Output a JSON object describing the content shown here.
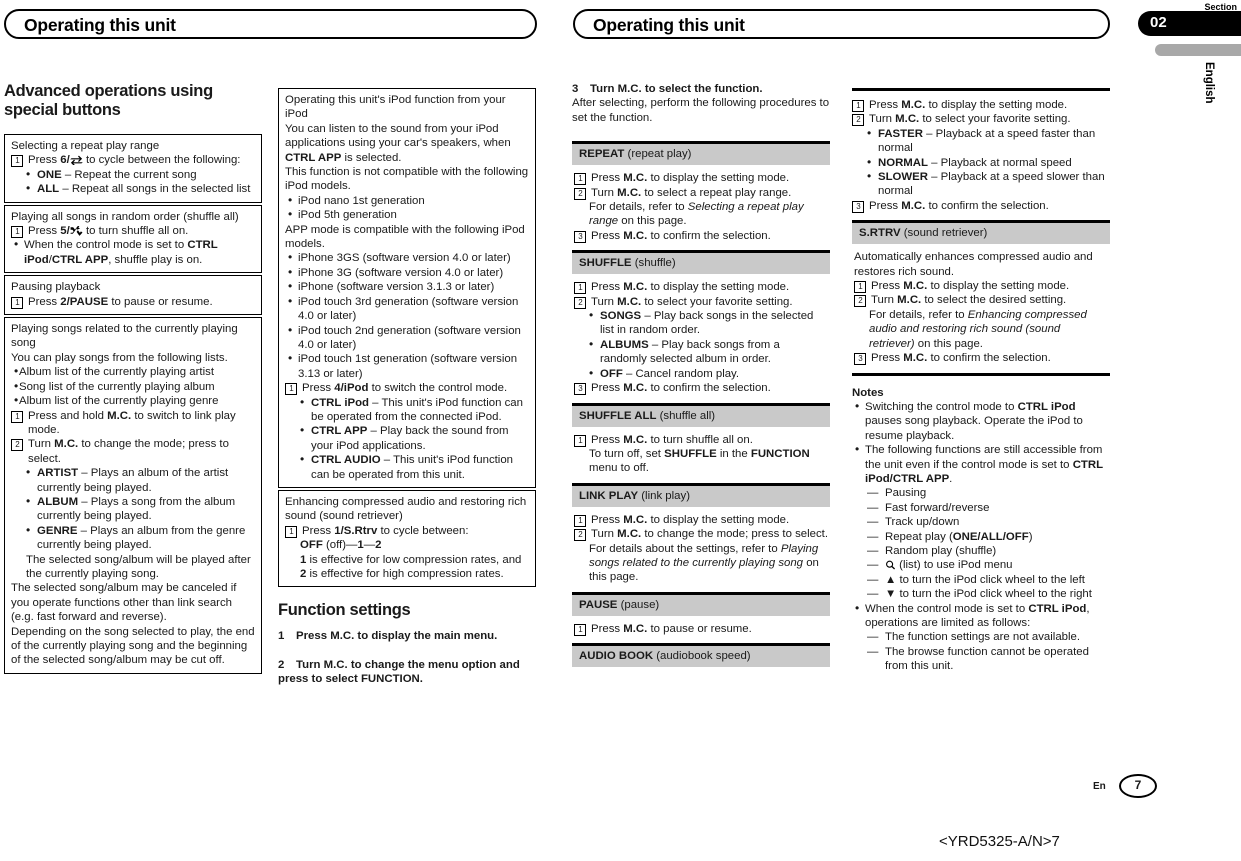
{
  "banners": {
    "left": "Operating this unit",
    "right": "Operating this unit"
  },
  "section_tab": {
    "label": "Section",
    "number": "02",
    "language": "English"
  },
  "footer": {
    "lang_code": "En",
    "page_number": "7",
    "doc_id": "<YRD5325-A/N>7"
  },
  "col1": {
    "heading": "Advanced operations using special buttons",
    "boxes": [
      {
        "title": "Selecting a repeat play range",
        "steps": [
          {
            "num": "1",
            "text_a": "Press ",
            "bold": "6/",
            "icon": "repeat-icon",
            "text_b": " to cycle between the following:"
          }
        ],
        "bullets": [
          {
            "bold": "ONE",
            "rest": " – Repeat the current song"
          },
          {
            "bold": "ALL",
            "rest": " – Repeat all songs in the selected list"
          }
        ]
      },
      {
        "title": "Playing all songs in random order (shuffle all)",
        "step1_a": "Press ",
        "step1_bold": "5/",
        "step1_icon": "shuffle-icon",
        "step1_b": " to turn shuffle all on.",
        "note": "When the control mode is set to CTRL iPod/CTRL APP, shuffle play is on."
      },
      {
        "title": "Pausing playback",
        "step1_a": "Press ",
        "step1_bold": "2/PAUSE",
        "step1_b": " to pause or resume."
      },
      {
        "title": "Playing songs related to the currently playing song",
        "intro": "You can play songs from the following lists.",
        "list": [
          "Album list of the currently playing artist",
          "Song list of the currently playing album",
          "Album list of the currently playing genre"
        ],
        "step1_a": "Press and hold ",
        "step1_bold": "M.C.",
        "step1_b": " to switch to link play mode.",
        "step2_a": "Turn ",
        "step2_bold": "M.C.",
        "step2_b": " to change the mode; press to select.",
        "modes": [
          {
            "bold": "ARTIST",
            "rest": " – Plays an album of the artist currently being played."
          },
          {
            "bold": "ALBUM",
            "rest": " – Plays a song from the album currently being played."
          },
          {
            "bold": "GENRE",
            "rest": " – Plays an album from the genre currently being played."
          }
        ],
        "after_modes": "The selected song/album will be played after the currently playing song.",
        "para1": "The selected song/album may be canceled if you operate functions other than link search (e.g. fast forward and reverse).",
        "para2": "Depending on the song selected to play, the end of the currently playing song and the beginning of the selected song/album may be cut off."
      }
    ]
  },
  "col2": {
    "box1": {
      "title": "Operating this unit's iPod function from your iPod",
      "p1_a": "You can listen to the sound from your iPod applications using your car's speakers, when ",
      "p1_bold": "CTRL APP",
      "p1_b": " is selected.",
      "p2": "This function is not compatible with the following iPod models.",
      "incompatible": [
        "iPod nano 1st generation",
        "iPod 5th generation"
      ],
      "p3": "APP mode is compatible with the following iPod models.",
      "compatible": [
        "iPhone 3GS (software version 4.0 or later)",
        "iPhone 3G (software version 4.0 or later)",
        "iPhone (software version 3.1.3 or later)",
        "iPod touch 3rd generation (software version 4.0 or later)",
        "iPod touch 2nd generation (software version 4.0 or later)",
        "iPod touch 1st generation (software version 3.13 or later)"
      ],
      "step1_a": "Press ",
      "step1_bold": "4/iPod",
      "step1_b": " to switch the control mode.",
      "modes": [
        {
          "bold": "CTRL iPod",
          "rest": " – This unit's iPod function can be operated from the connected iPod."
        },
        {
          "bold": "CTRL APP",
          "rest": " – Play back the sound from your iPod applications."
        },
        {
          "bold": "CTRL AUDIO",
          "rest": " – This unit's iPod function can be operated from this unit."
        }
      ]
    },
    "box2": {
      "title": "Enhancing compressed audio and restoring rich sound (sound retriever)",
      "step1_a": "Press ",
      "step1_bold": "1/S.Rtrv",
      "step1_b": " to cycle between:",
      "cycle_bold1": "OFF",
      "cycle_rest": " (off)—",
      "cycle_bold2": "1",
      "cycle_dash": "—",
      "cycle_bold3": "2",
      "note_a": "1",
      "note_b": " is effective for low compression rates, and ",
      "note_c": "2",
      "note_d": " is effective for high compression rates."
    },
    "function_settings": {
      "heading": "Function settings",
      "step1_num": "1",
      "step1": "Press M.C. to display the main menu.",
      "step2_num": "2",
      "step2": "Turn M.C. to change the menu option and press to select FUNCTION."
    }
  },
  "col3": {
    "step3_num": "3",
    "step3_title": "Turn M.C. to select the function.",
    "step3_body": "After selecting, perform the following procedures to set the function.",
    "functions": [
      {
        "name": "REPEAT",
        "paren": "(repeat play)",
        "steps": [
          {
            "num": "1",
            "a": "Press ",
            "bold": "M.C.",
            "b": " to display the setting mode."
          },
          {
            "num": "2",
            "a": "Turn ",
            "bold": "M.C.",
            "b": " to select a repeat play range."
          },
          {
            "num": "3",
            "a": "Press ",
            "bold": "M.C.",
            "b": " to confirm the selection."
          }
        ],
        "detail_a": "For details, refer to ",
        "detail_i": "Selecting a repeat play range",
        "detail_b": " on this page."
      },
      {
        "name": "SHUFFLE",
        "paren": "(shuffle)",
        "steps": [
          {
            "num": "1",
            "a": "Press ",
            "bold": "M.C.",
            "b": " to display the setting mode."
          },
          {
            "num": "2",
            "a": "Turn ",
            "bold": "M.C.",
            "b": " to select your favorite setting."
          },
          {
            "num": "3",
            "a": "Press ",
            "bold": "M.C.",
            "b": " to confirm the selection."
          }
        ],
        "options": [
          {
            "bold": "SONGS",
            "rest": " – Play back songs in the selected list in random order."
          },
          {
            "bold": "ALBUMS",
            "rest": " – Play back songs from a randomly selected album in order."
          },
          {
            "bold": "OFF",
            "rest": " – Cancel random play."
          }
        ]
      },
      {
        "name": "SHUFFLE ALL",
        "paren": "(shuffle all)",
        "steps": [
          {
            "num": "1",
            "a": "Press ",
            "bold": "M.C.",
            "b": " to turn shuffle all on."
          }
        ],
        "extra_a": "To turn off, set ",
        "extra_bold1": "SHUFFLE",
        "extra_mid": " in the ",
        "extra_bold2": "FUNCTION",
        "extra_b": " menu to off."
      },
      {
        "name": "LINK PLAY",
        "paren": "(link play)",
        "steps": [
          {
            "num": "1",
            "a": "Press ",
            "bold": "M.C.",
            "b": " to display the setting mode."
          },
          {
            "num": "2",
            "a": "Turn ",
            "bold": "M.C.",
            "b": " to change the mode; press to select."
          }
        ],
        "detail_a": "For details about the settings, refer to ",
        "detail_i": "Playing songs related to the currently playing song",
        "detail_b": " on this page."
      },
      {
        "name": "PAUSE",
        "paren": "(pause)",
        "steps": [
          {
            "num": "1",
            "a": "Press ",
            "bold": "M.C.",
            "b": " to pause or resume."
          }
        ]
      },
      {
        "name": "AUDIO BOOK",
        "paren": "(audiobook speed)"
      }
    ]
  },
  "col4": {
    "audiobook_steps": [
      {
        "num": "1",
        "a": "Press ",
        "bold": "M.C.",
        "b": " to display the setting mode."
      },
      {
        "num": "2",
        "a": "Turn ",
        "bold": "M.C.",
        "b": " to select your favorite setting."
      },
      {
        "num": "3",
        "a": "Press ",
        "bold": "M.C.",
        "b": " to confirm the selection."
      }
    ],
    "audiobook_options": [
      {
        "bold": "FASTER",
        "rest": " – Playback at a speed faster than normal"
      },
      {
        "bold": "NORMAL",
        "rest": " – Playback at normal speed"
      },
      {
        "bold": "SLOWER",
        "rest": " – Playback at a speed slower than normal"
      }
    ],
    "srtrv": {
      "name": "S.RTRV",
      "paren": "(sound retriever)",
      "intro": "Automatically enhances compressed audio and restores rich sound.",
      "steps": [
        {
          "num": "1",
          "a": "Press ",
          "bold": "M.C.",
          "b": " to display the setting mode."
        },
        {
          "num": "2",
          "a": "Turn ",
          "bold": "M.C.",
          "b": " to select the desired setting."
        },
        {
          "num": "3",
          "a": "Press ",
          "bold": "M.C.",
          "b": " to confirm the selection."
        }
      ],
      "detail_a": "For details, refer to ",
      "detail_i": "Enhancing compressed audio and restoring rich sound (sound retriever)",
      "detail_b": " on this page."
    },
    "notes": {
      "heading": "Notes",
      "note1_a": "Switching the control mode to ",
      "note1_bold": "CTRL iPod",
      "note1_b": " pauses song playback. Operate the iPod to resume playback.",
      "note2_a": "The following functions are still accessible from the unit even if the control mode is set to ",
      "note2_bold": "CTRL iPod/CTRL APP",
      "note2_b": ".",
      "note2_items": [
        "Pausing",
        "Fast forward/reverse",
        "Track up/down",
        "Repeat play (ONE/ALL/OFF)",
        "Random play (shuffle)",
        "(list) to use iPod menu",
        "to turn the iPod click wheel to the left",
        "to turn the iPod click wheel to the right"
      ],
      "note3_a": "When the control mode is set to ",
      "note3_bold": "CTRL iPod",
      "note3_b": ", operations are limited as follows:",
      "note3_items": [
        "The function settings are not available.",
        "The browse function cannot be operated from this unit."
      ]
    }
  }
}
